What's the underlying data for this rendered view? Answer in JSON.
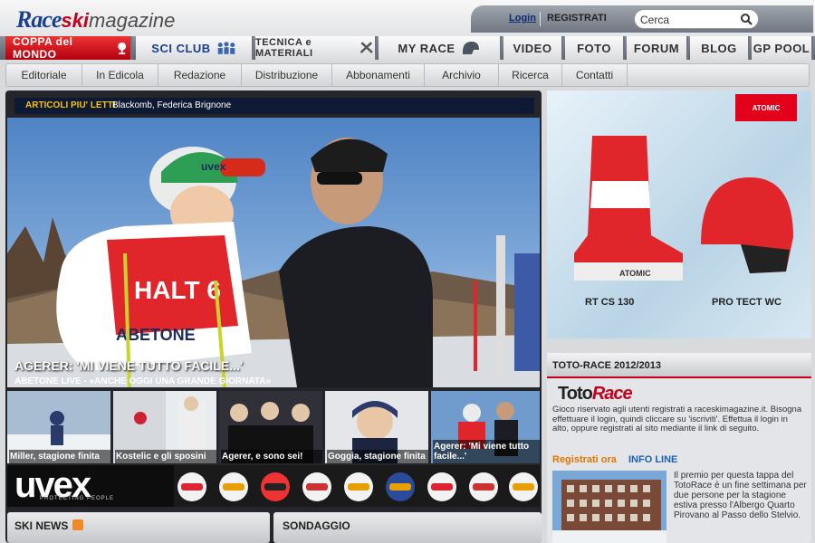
{
  "brand": {
    "race": "Race",
    "ski": "ski",
    "magazine": "magazine"
  },
  "user_bar": {
    "login": "Login",
    "register": "REGISTRATI",
    "search_value": "Cerca"
  },
  "main_nav": {
    "coppa": "COPPA del MONDO",
    "sciclub": "SCI CLUB",
    "tecnica": "TECNICA e MATERIALI",
    "myrace": "MY RACE",
    "video": "VIDEO",
    "foto": "FOTO",
    "forum": "FORUM",
    "blog": "BLOG",
    "gppool": "GP POOL"
  },
  "sub_nav": [
    "Editoriale",
    "In Edicola",
    "Redazione",
    "Distribuzione",
    "Abbonamenti",
    "Archivio",
    "Ricerca",
    "Contatti"
  ],
  "ticker": {
    "label": "ARTICOLI PIU' LETTI",
    "text": "Blackomb, Federica Brignone"
  },
  "hero": {
    "title": "AGERER: 'MI VIENE TUTTO FACILE...'",
    "subtitle": "ABETONE LIVE - «ANCHE OGGI UNA GRANDE GIORNATA»",
    "bib": "HALT 6",
    "bib_sponsor": "ABETONE",
    "helmet_brand": "uvex"
  },
  "thumbs": [
    {
      "caption": "Miller, stagione finita"
    },
    {
      "caption": "Kostelic e gli sposini"
    },
    {
      "caption": "Agerer, e sono sei!"
    },
    {
      "caption": "Goggia, stagione finita"
    },
    {
      "caption": "Agerer: 'Mi viene tutto facile...'"
    }
  ],
  "uvex_banner": {
    "logo": "uvex",
    "tagline": "PROTECTING PEOPLE"
  },
  "ski_news": {
    "title": "SKI NEWS"
  },
  "sondaggio": {
    "title": "SONDAGGIO"
  },
  "ad": {
    "brand": "ATOMIC",
    "boot": "RT CS 130",
    "helmet": "PRO TECT WC",
    "boot_brand": "ATOMIC"
  },
  "toto": {
    "title": "TOTO-RACE 2012/2013",
    "logo_a": "Toto",
    "logo_b": "Race",
    "text": "Gioco riservato agli utenti registrati a raceskimagazine.it. Bisogna effettuare il login, quindi cliccare su 'iscriviti'. Effettua il login in alto, oppure registrati al sito mediante il link di seguito.",
    "register": "Registrati ora",
    "info": "INFO LINE",
    "prize": "Il premio per questa tappa del TotoRace è un fine settimana per due persone per la stagione estiva presso l'Albergo Quarto Pirovano al Passo dello Stelvio."
  },
  "colors": {
    "accent_red": "#c4001a",
    "brand_blue": "#1b3f8f",
    "ticker_yellow": "#f6c400"
  }
}
